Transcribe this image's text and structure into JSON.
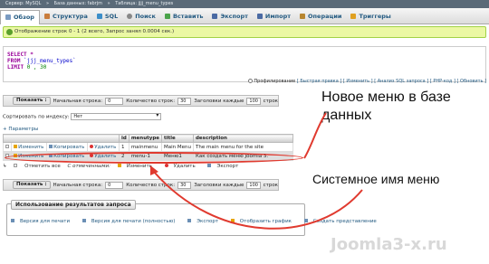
{
  "breadcrumb": [
    "Сервер: MySQL",
    "»",
    "База данных: fabrjm",
    "»",
    "Таблица: jjjj_menu_types"
  ],
  "tabs": [
    "Обзор",
    "Структура",
    "SQL",
    "Поиск",
    "Вставить",
    "Экспорт",
    "Импорт",
    "Операции",
    "Триггеры"
  ],
  "success_msg": "Отображение строк 0 - 1 (2 всего, Запрос занял 0.0004 сек.)",
  "sql": {
    "line1": "SELECT *",
    "from_kw": "FROM",
    "from_tbl": "`jjj_menu_types`",
    "limit_kw": "LIMIT",
    "limit_val": "0 , 30"
  },
  "profiling": {
    "label": "Профилирование",
    "links": "[ Быстрая правка ] [ Изменить ] [ Анализ SQL запроса ] [ PHP-код ] [ Обновить ]"
  },
  "nav": {
    "show_btn": "Показать :",
    "start_label": "Начальная строка:",
    "start_val": "0",
    "count_label": "Количество строк:",
    "count_val": "30",
    "headers_label": "Заголовки каждые",
    "headers_val": "100",
    "rows_label": "строк"
  },
  "sort": {
    "label": "Сортировать по индексу:",
    "value": "Нет"
  },
  "params_label": "+ Параметры",
  "table": {
    "columns": [
      "id",
      "menutype",
      "title",
      "description"
    ],
    "rows": [
      {
        "edit": "Изменить",
        "copy": "Копировать",
        "delete": "Удалить",
        "id": "1",
        "menutype": "mainmenu",
        "title": "Main Menu",
        "description": "The main menu for the site"
      },
      {
        "edit": "Изменить",
        "copy": "Копировать",
        "delete": "Удалить",
        "id": "2",
        "menutype": "menu-1",
        "title": "Меню1",
        "description": "Как создать меню Joomla 3."
      }
    ]
  },
  "bulk": {
    "check_all": "Отметить все",
    "with_selected": "С отмеченными:",
    "edit": "Изменить",
    "delete": "Удалить",
    "export": "Экспорт"
  },
  "ops": {
    "legend": "Использование результатов запроса",
    "print": "Версия для печати",
    "print_full": "Версия для печати (полностью)",
    "export": "Экспорт",
    "chart": "Отобразить график",
    "view": "Создать представление"
  },
  "annotations": {
    "new_menu": "Новое меню в базе данных",
    "system_name": "Системное имя меню",
    "watermark": "Joomla3-x.ru",
    "color": "#e03a2f"
  }
}
